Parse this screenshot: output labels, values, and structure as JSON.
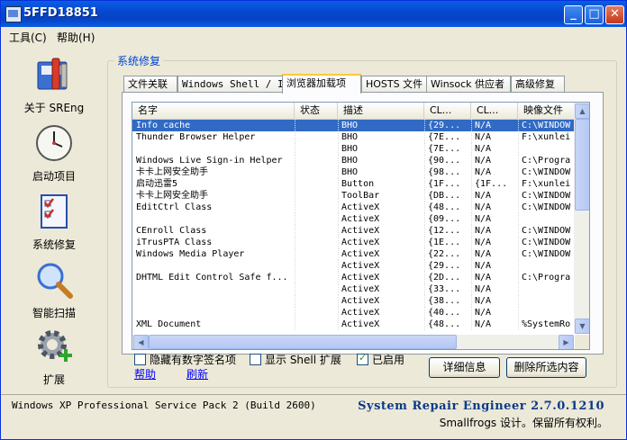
{
  "window": {
    "title": "5FFD18851"
  },
  "menu": [
    {
      "label": "工具(C)"
    },
    {
      "label": "帮助(H)"
    }
  ],
  "sidebar": {
    "items": [
      {
        "label": "关于 SREng",
        "icon": "toolbox-icon"
      },
      {
        "label": "启动项目",
        "icon": "clock-icon"
      },
      {
        "label": "系统修复",
        "icon": "checklist-icon"
      },
      {
        "label": "智能扫描",
        "icon": "magnifier-icon"
      },
      {
        "label": "扩展",
        "icon": "gear-plus-icon"
      }
    ]
  },
  "main": {
    "group_title": "系统修复",
    "tabs": [
      {
        "label": "文件关联"
      },
      {
        "label": "Windows Shell / IE"
      },
      {
        "label": "浏览器加载项",
        "active": true
      },
      {
        "label": "HOSTS 文件"
      },
      {
        "label": "Winsock 供应者"
      },
      {
        "label": "高级修复"
      }
    ],
    "list": {
      "columns": [
        "名字",
        "状态",
        "描述",
        "CL...",
        "CL...",
        "映像文件"
      ],
      "rows": [
        [
          "Info cache",
          "",
          "BHO",
          "{29...",
          "N/A",
          "C:\\WINDOW"
        ],
        [
          "Thunder Browser Helper",
          "",
          "BHO",
          "{7E...",
          "N/A",
          "F:\\xunlei"
        ],
        [
          "",
          "",
          "BHO",
          "{7E...",
          "N/A",
          ""
        ],
        [
          "Windows Live Sign-in Helper",
          "",
          "BHO",
          "{90...",
          "N/A",
          "C:\\Progra"
        ],
        [
          "卡卡上网安全助手",
          "",
          "BHO",
          "{98...",
          "N/A",
          "C:\\WINDOW"
        ],
        [
          "启动迅雷5",
          "",
          "Button",
          "{1F...",
          "{1F...",
          "F:\\xunlei"
        ],
        [
          "卡卡上网安全助手",
          "",
          "ToolBar",
          "{DB...",
          "N/A",
          "C:\\WINDOW"
        ],
        [
          "EditCtrl Class",
          "",
          "ActiveX",
          "{48...",
          "N/A",
          "C:\\WINDOW"
        ],
        [
          "",
          "",
          "ActiveX",
          "{09...",
          "N/A",
          ""
        ],
        [
          "CEnroll Class",
          "",
          "ActiveX",
          "{12...",
          "N/A",
          "C:\\WINDOW"
        ],
        [
          "iTrusPTA Class",
          "",
          "ActiveX",
          "{1E...",
          "N/A",
          "C:\\WINDOW"
        ],
        [
          "Windows Media Player",
          "",
          "ActiveX",
          "{22...",
          "N/A",
          "C:\\WINDOW"
        ],
        [
          "",
          "",
          "ActiveX",
          "{29...",
          "N/A",
          ""
        ],
        [
          "DHTML Edit Control Safe f...",
          "",
          "ActiveX",
          "{2D...",
          "N/A",
          "C:\\Progra"
        ],
        [
          "",
          "",
          "ActiveX",
          "{33...",
          "N/A",
          ""
        ],
        [
          "",
          "",
          "ActiveX",
          "{38...",
          "N/A",
          ""
        ],
        [
          "",
          "",
          "ActiveX",
          "{40...",
          "N/A",
          ""
        ],
        [
          "XML Document",
          "",
          "ActiveX",
          "{48...",
          "N/A",
          "%SystemRo"
        ]
      ]
    },
    "options": {
      "hide_signed": {
        "label": "隐藏有数字签名项",
        "checked": false
      },
      "show_shell": {
        "label": "显示 Shell 扩展",
        "checked": false
      },
      "enabled": {
        "label": "已启用",
        "checked": true
      }
    },
    "links": {
      "help": "帮助",
      "refresh": "刷新"
    },
    "buttons": {
      "details": "详细信息",
      "delete": "删除所选内容"
    }
  },
  "status": {
    "os": "Windows XP Professional Service Pack 2 (Build 2600)",
    "brand": "System Repair Engineer 2.7.0.1210",
    "copyright": "Smallfrogs 设计。保留所有权利。"
  },
  "colors": {
    "titlebar": "#0a5ee5",
    "selection": "#316ac5",
    "link": "#0000ff",
    "brand": "#0c3a8a"
  }
}
